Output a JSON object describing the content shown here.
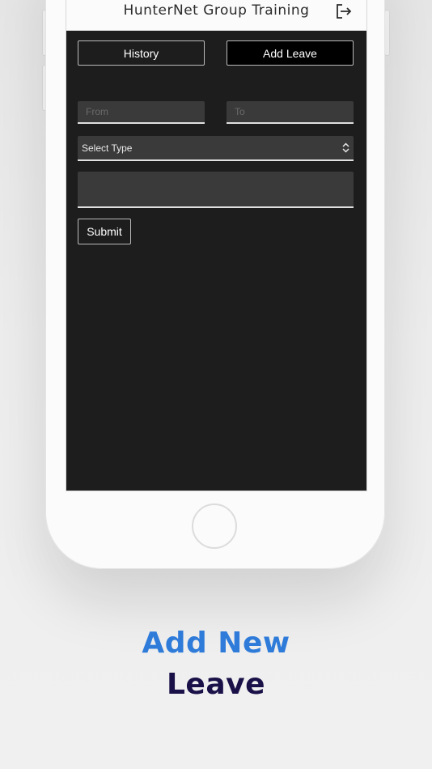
{
  "app": {
    "title": "HunterNet Group Training",
    "logout_icon": "logout-icon"
  },
  "tabs": {
    "history_label": "History",
    "add_leave_label": "Add Leave"
  },
  "form": {
    "from_placeholder": "From",
    "to_placeholder": "To",
    "type_selected": "Select Type",
    "submit_label": "Submit"
  },
  "promo": {
    "line1": "Add New",
    "line2": "Leave",
    "line1_color": "#2e7bd9",
    "line2_color": "#1a1148"
  }
}
